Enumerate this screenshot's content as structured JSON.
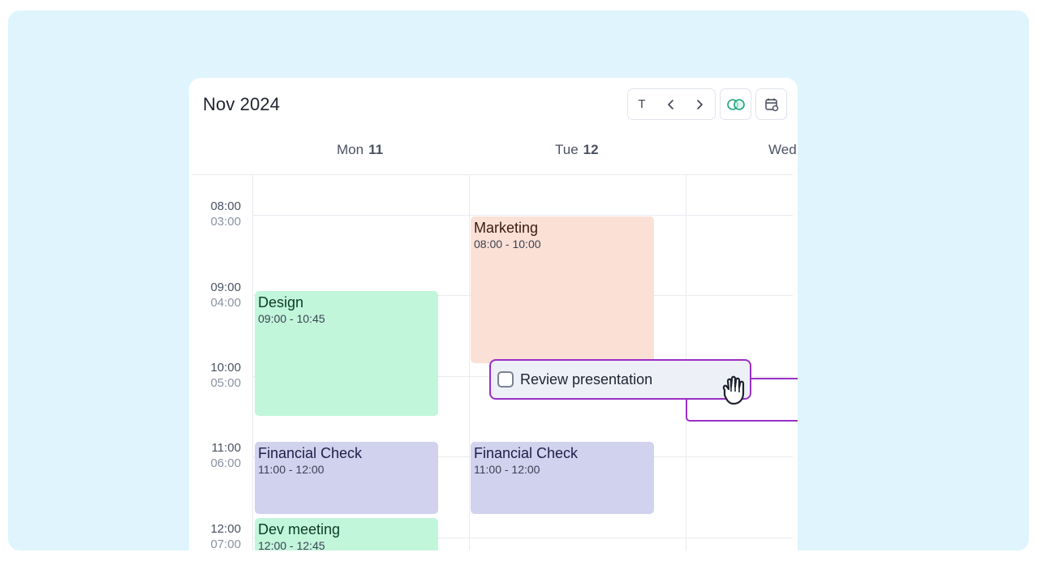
{
  "header": {
    "title": "Nov 2024",
    "today_label": "T"
  },
  "days": [
    {
      "name": "Mon",
      "num": "11"
    },
    {
      "name": "Tue",
      "num": "12"
    },
    {
      "name": "Wed",
      "num": ""
    }
  ],
  "times": [
    {
      "primary": "08:00",
      "secondary": "03:00"
    },
    {
      "primary": "09:00",
      "secondary": "04:00"
    },
    {
      "primary": "10:00",
      "secondary": "05:00"
    },
    {
      "primary": "11:00",
      "secondary": "06:00"
    },
    {
      "primary": "12:00",
      "secondary": "07:00"
    }
  ],
  "events": {
    "marketing": {
      "title": "Marketing",
      "time": "08:00 - 10:00"
    },
    "design": {
      "title": "Design",
      "time": "09:00 - 10:45"
    },
    "financial_mon": {
      "title": "Financial Check",
      "time": "11:00 - 12:00"
    },
    "financial_tue": {
      "title": "Financial Check",
      "time": "11:00 - 12:00"
    },
    "dev_meeting": {
      "title": "Dev meeting",
      "time": "12:00 - 12:45"
    }
  },
  "drag_task": {
    "label": "Review presentation"
  },
  "icons": {
    "today": "today-button",
    "prev": "chevron-left-icon",
    "next": "chevron-right-icon",
    "toggle": "dual-calendar-toggle-icon",
    "settings": "calendar-settings-icon",
    "cursor": "grab-hand-cursor-icon"
  },
  "colors": {
    "background": "#dff4fc",
    "event_green": "#c2f6db",
    "event_salmon": "#fbe0d6",
    "event_blue": "#d0d2ee",
    "drag_border": "#9a2fc4",
    "toggle_accent": "#1aa37a"
  }
}
